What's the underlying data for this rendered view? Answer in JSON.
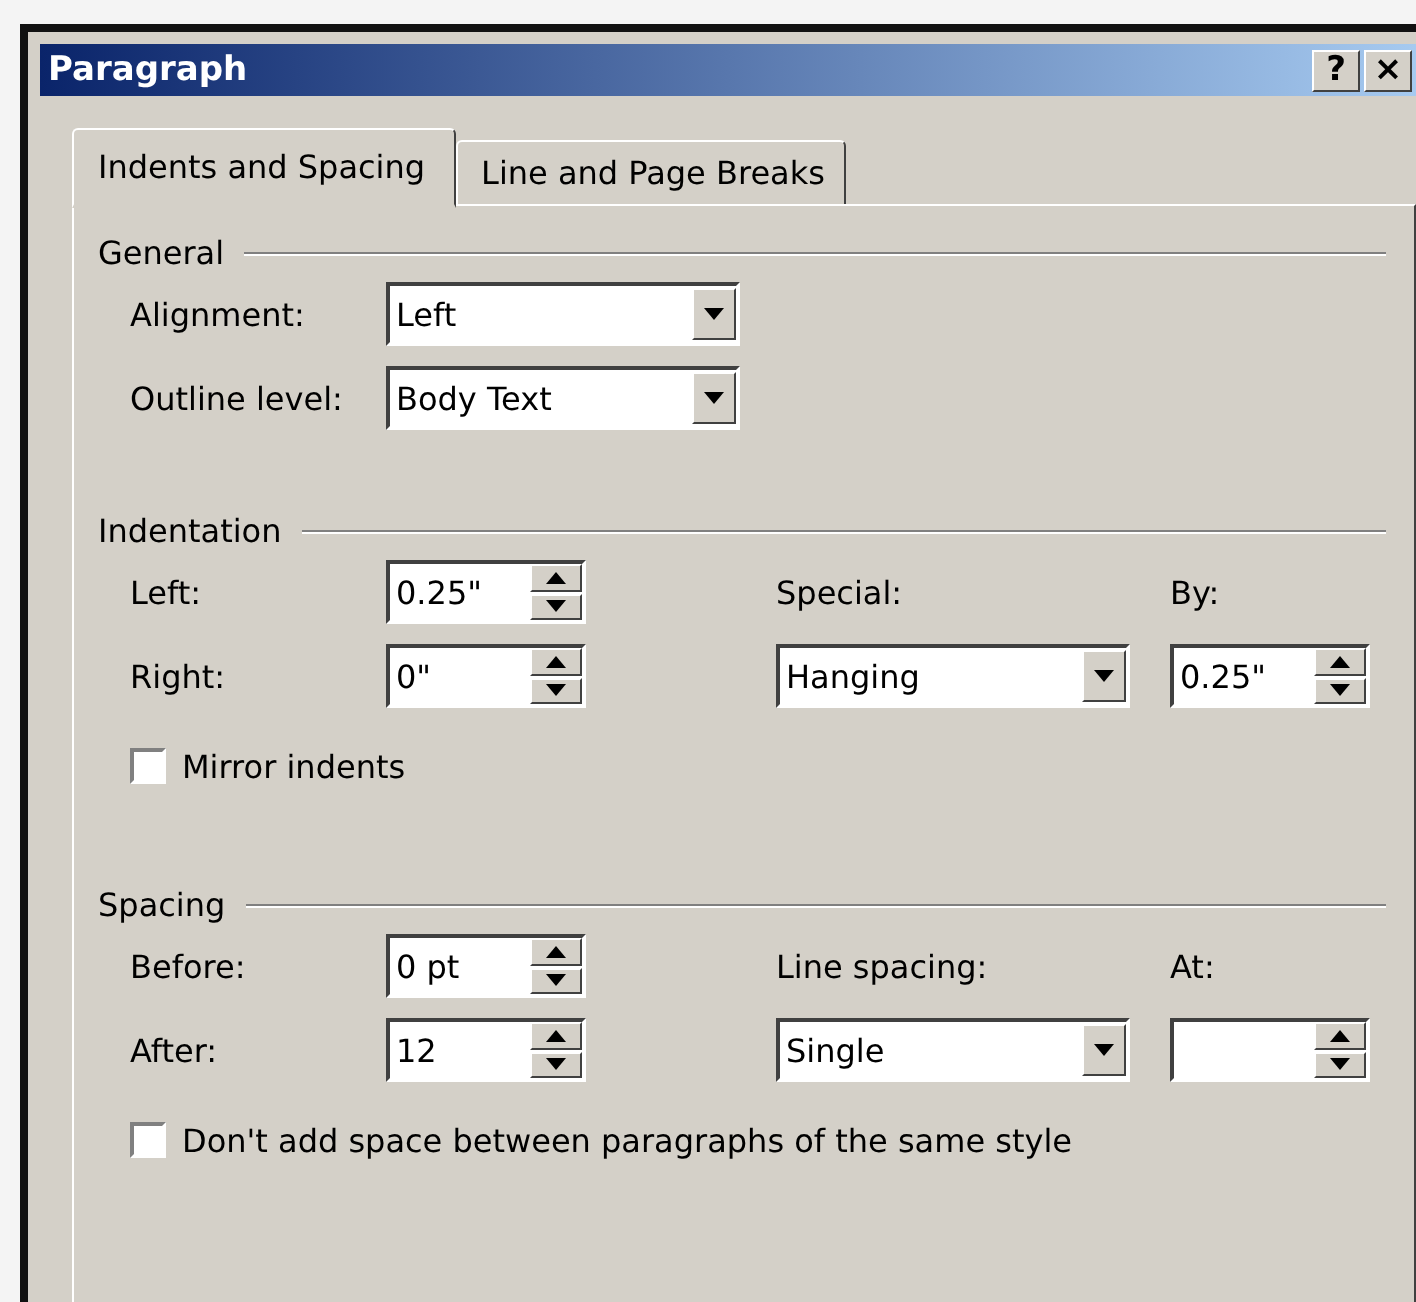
{
  "window": {
    "title": "Paragraph",
    "buttons": [
      "?",
      "×"
    ]
  },
  "tabs": [
    {
      "label": "Indents and Spacing",
      "selected": true
    },
    {
      "label": "Line and Page Breaks",
      "selected": false
    }
  ],
  "sections": [
    {
      "title": "General",
      "rows": [
        [
          {
            "kind": "label",
            "text": "Alignment:"
          },
          {
            "kind": "combo",
            "value": "Left"
          }
        ],
        [
          {
            "kind": "label",
            "text": "Outline level:"
          },
          {
            "kind": "combo",
            "value": "Body Text"
          }
        ]
      ]
    },
    {
      "title": "Indentation",
      "rows": [
        [
          {
            "kind": "label",
            "text": "Left:"
          },
          {
            "kind": "spin",
            "value": "0.25\""
          },
          {
            "kind": "label",
            "text": "Special:"
          },
          {
            "kind": "label",
            "text": "By:"
          }
        ],
        [
          {
            "kind": "label",
            "text": "Right:"
          },
          {
            "kind": "spin",
            "value": "0\""
          },
          {
            "kind": "combo",
            "value": "Hanging"
          },
          {
            "kind": "spin",
            "value": "0.25\""
          }
        ],
        [
          {
            "kind": "checkbox",
            "text": "Mirror indents",
            "checked": false
          }
        ]
      ]
    },
    {
      "title": "Spacing",
      "rows": [
        [
          {
            "kind": "label",
            "text": "Before:"
          },
          {
            "kind": "spin",
            "value": "0 pt"
          },
          {
            "kind": "label",
            "text": "Line spacing:"
          },
          {
            "kind": "label",
            "text": "At:"
          }
        ],
        [
          {
            "kind": "label",
            "text": "After:"
          },
          {
            "kind": "spin",
            "value": "12"
          },
          {
            "kind": "combo",
            "value": "Single"
          },
          {
            "kind": "spin"
          }
        ],
        [
          {
            "kind": "checkbox",
            "text": "Don't add space between paragraphs of the same style",
            "checked": false
          }
        ]
      ]
    }
  ]
}
